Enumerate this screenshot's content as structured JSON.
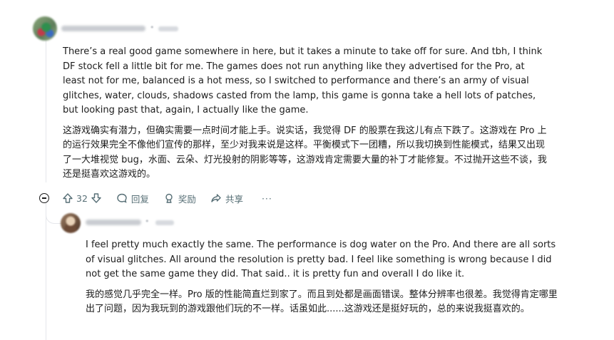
{
  "comment": {
    "score": "32",
    "body_en": "There’s a real good game somewhere in here, but it takes a minute to take off for sure. And tbh, I think DF stock fell a little bit for me. The games does not run anything like they advertised for the Pro, at least not for me, balanced is a hot mess, so I switched to performance and there’s an army of visual glitches, water, clouds, shadows casted from the lamp, this game is gonna take a hell lots of patches, but looking past that, again, I actually like the game.",
    "body_zh": "这游戏确实有潜力，但确实需要一点时间才能上手。说实话，我觉得 DF 的股票在我这儿有点下跌了。这游戏在 Pro 上的运行效果完全不像他们宣传的那样，至少对我来说是这样。平衡模式下一团糟，所以我切换到性能模式，结果又出现了一大堆视觉 bug，水面、云朵、灯光投射的阴影等等，这游戏肯定需要大量的补丁才能修复。不过抛开这些不谈，我还是挺喜欢这游戏的。",
    "actions": {
      "reply_label": "回复",
      "award_label": "奖励",
      "share_label": "共享",
      "more_label": "···"
    }
  },
  "reply": {
    "body_en": "I feel pretty much exactly the same. The performance is dog water on the Pro. And there are all sorts of visual glitches. All around the resolution is pretty bad. I feel like something is wrong because I did not get the same game they did. That said.. it is pretty fun and overall I do like it.",
    "body_zh": "我的感觉几乎完全一样。Pro 版的性能简直烂到家了。而且到处都是画面错误。整体分辨率也很差。我觉得肯定哪里出了问题，因为我玩到的游戏跟他们玩的不一样。话虽如此......这游戏还是挺好玩的，总的来说我挺喜欢的。"
  },
  "icons": [
    "collapse-icon",
    "upvote-icon",
    "downvote-icon",
    "reply-icon",
    "award-icon",
    "share-icon",
    "more-icon"
  ],
  "colors": {
    "text": "#1c1c1c",
    "action_text": "#576f76",
    "thread_line": "#e5e7eb"
  }
}
